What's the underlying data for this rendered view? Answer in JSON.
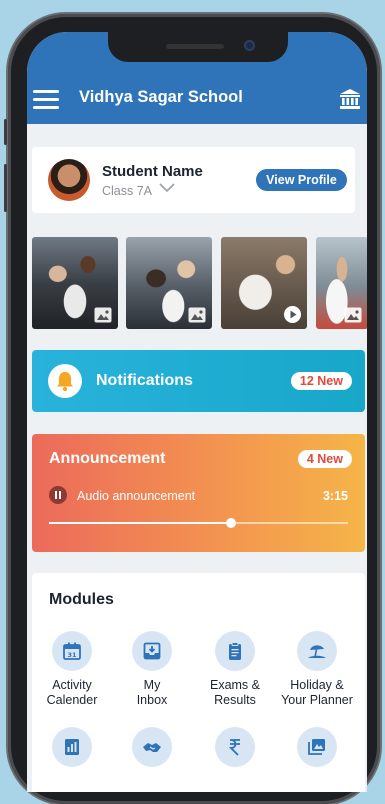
{
  "app": {
    "title": "Vidhya Sagar School"
  },
  "profile": {
    "name": "Student Name",
    "class_label": "Class 7A",
    "view_profile_label": "View Profile"
  },
  "gallery": {
    "items": [
      {
        "type": "image",
        "icon": "image-icon"
      },
      {
        "type": "image",
        "icon": "image-icon"
      },
      {
        "type": "video",
        "icon": "play-icon"
      },
      {
        "type": "image",
        "icon": "image-icon"
      }
    ]
  },
  "notifications": {
    "label": "Notifications",
    "badge": "12 New"
  },
  "announcement": {
    "title": "Announcement",
    "badge": "4 New",
    "audio_label": "Audio announcement",
    "duration": "3:15",
    "progress": 0.61
  },
  "modules": {
    "title": "Modules",
    "items": [
      {
        "line1": "Activity",
        "line2": "Calender",
        "icon": "calendar-icon"
      },
      {
        "line1": "My",
        "line2": "Inbox",
        "icon": "inbox-icon"
      },
      {
        "line1": "Exams &",
        "line2": "Results",
        "icon": "clipboard-icon"
      },
      {
        "line1": "Holiday &",
        "line2": "Your Planner",
        "icon": "beach-icon"
      },
      {
        "line1": "",
        "line2": "",
        "icon": "report-icon"
      },
      {
        "line1": "",
        "line2": "",
        "icon": "handshake-icon"
      },
      {
        "line1": "",
        "line2": "",
        "icon": "rupee-icon"
      },
      {
        "line1": "",
        "line2": "",
        "icon": "photo-gallery-icon"
      }
    ]
  },
  "colors": {
    "primary": "#2f73b8",
    "notification": "#1aaed3",
    "announcement_start": "#ec6a5b",
    "announcement_end": "#f5b548",
    "badge_text": "#e04a3c"
  }
}
